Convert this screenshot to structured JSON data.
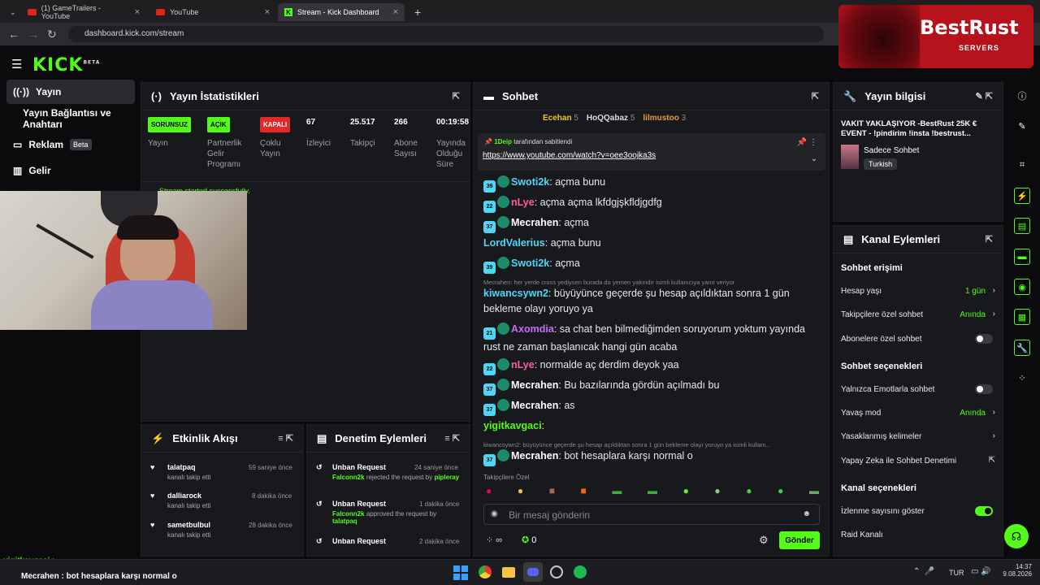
{
  "browser": {
    "tabs": [
      {
        "label": "(1) GameTrailers - YouTube"
      },
      {
        "label": "YouTube"
      },
      {
        "label": "Stream - Kick Dashboard"
      }
    ],
    "url": "dashboard.kick.com/stream"
  },
  "kick": {
    "logo": "KICK",
    "logo_sup": "BETA"
  },
  "sidebar": {
    "items": [
      {
        "label": "Yayın"
      },
      {
        "label": "Yayın Bağlantısı ve Anahtarı"
      },
      {
        "label": "Reklam",
        "badge": "Beta"
      },
      {
        "label": "Gelir"
      }
    ]
  },
  "overlay": {
    "brand": "BestRust",
    "brand_sub": "SERVERS"
  },
  "stats": {
    "title": "Yayın İstatistikleri",
    "items": [
      {
        "badge": "SORUNSUZ",
        "badge_color": "#53fc18",
        "label": "Yayın"
      },
      {
        "badge": "AÇIK",
        "badge_color": "#53fc18",
        "label": "Partnerlik Gelir Programı"
      },
      {
        "badge": "KAPALI",
        "badge_color": "#e02a2a",
        "label": "Çoklu Yayın"
      },
      {
        "value": "67",
        "label": "İzleyici"
      },
      {
        "value": "25.517",
        "label": "Takipçi"
      },
      {
        "value": "266",
        "label": "Abone Sayısı"
      },
      {
        "value": "00:19:58",
        "label": "Yayında Olduğu Süre"
      }
    ],
    "toast": "Stream started successfully."
  },
  "chat": {
    "title": "Sohbet",
    "top": [
      {
        "name": "Ecehan",
        "count": "5"
      },
      {
        "name": "HoQQabaz",
        "count": "5"
      },
      {
        "name": "lilmustoo",
        "count": "3"
      }
    ],
    "pinned": {
      "by": "1Deip",
      "by_suffix": "tarafından sabitlendi",
      "link": "https://www.youtube.com/watch?v=oee3oojka3s"
    },
    "messages": [
      {
        "badge": "39",
        "user": "Swoti2k",
        "color": "#4fd6f7",
        "text": "açma bunu"
      },
      {
        "badge": "22",
        "user": "nLye",
        "color": "#ff5ca8",
        "text": "açma açma lkfdgjşkfldjgdfg"
      },
      {
        "badge": "37",
        "user": "Mecrahen",
        "color": "#ffffff",
        "text": "açma"
      },
      {
        "badge": "",
        "user": "LordValerius",
        "color": "#4fd6f7",
        "text": "açma bunu"
      },
      {
        "badge": "39",
        "user": "Swoti2k",
        "color": "#4fd6f7",
        "text": "açma"
      },
      {
        "reply": "Mecrahen: her yerde cross yediysen burada da yemen yakındır isimli kullanıcıya yanıt veriyor"
      },
      {
        "badge": "",
        "user": "kiwancsywn2",
        "color": "#4fd6f7",
        "text": "büyüyünce geçerde şu hesap açıldıktan sonra 1 gün bekleme olayı yoruyo ya"
      },
      {
        "badge": "21",
        "user": "Axomdia",
        "color": "#c46bff",
        "text": "sa chat ben bilmediğimden soruyorum yoktum yayında rust ne zaman başlanıcak hangi gün acaba"
      },
      {
        "badge": "22",
        "user": "nLye",
        "color": "#ff5ca8",
        "text": "normalde aç derdim deyok yaa"
      },
      {
        "badge": "37",
        "user": "Mecrahen",
        "color": "#ffffff",
        "text": "Bu bazılarında gördün açılmadı bu"
      },
      {
        "badge": "37",
        "user": "Mecrahen",
        "color": "#ffffff",
        "text": "as"
      },
      {
        "badge": "",
        "user": "yigitkavgaci",
        "color": "#53fc18",
        "text": ""
      },
      {
        "reply": "kiwancsywn2: büyüyünce geçerde şu hesap açıldıktan sonra 1 gün bekleme olayı yoruyo ya isimli kullanı..."
      },
      {
        "badge": "37",
        "user": "Mecrahen",
        "color": "#ffffff",
        "text": "bot hesaplara karşı normal o"
      }
    ],
    "followers_only": "Takipçilere Özel",
    "input_placeholder": "Bir mesaj gönderin",
    "points": "0",
    "send": "Gönder"
  },
  "info": {
    "title": "Yayın bilgisi",
    "stream_title": "VAKIT YAKLAŞIYOR -BestRust 25K € EVENT - !pindirim !insta !bestrust...",
    "category": "Sadece Sohbet",
    "language": "Turkish"
  },
  "actions": {
    "title": "Kanal Eylemleri",
    "sections": [
      {
        "heading": "Sohbet erişimi"
      },
      {
        "heading": "Sohbet seçenekleri"
      },
      {
        "heading": "Kanal seçenekleri"
      }
    ],
    "rows": [
      {
        "label": "Hesap yaşı",
        "value": "1 gün"
      },
      {
        "label": "Takipçilere özel sohbet",
        "value": "Anında"
      },
      {
        "label": "Abonelere özel sohbet",
        "value": ""
      },
      {
        "label": "Yalnızca Emotlarla sohbet",
        "value": ""
      },
      {
        "label": "Yavaş mod",
        "value": "Anında"
      },
      {
        "label": "Yasaklanmış kelimeler",
        "value": ""
      },
      {
        "label": "Yapay Zeka ile Sohbet Denetimi",
        "value": ""
      },
      {
        "label": "İzlenme sayısını göster",
        "value": ""
      },
      {
        "label": "Raid Kanalı",
        "value": ""
      }
    ]
  },
  "events": {
    "title": "Etkinlik Akışı",
    "items": [
      {
        "user": "talatpaq",
        "action": "kanalı takip etti",
        "time": "59 saniye önce"
      },
      {
        "user": "dalliarock",
        "action": "kanalı takip etti",
        "time": "8 dakika önce"
      },
      {
        "user": "sametbulbul",
        "action": "kanalı takip etti",
        "time": "28 dakika önce"
      }
    ]
  },
  "moderation": {
    "title": "Denetim Eylemleri",
    "items": [
      {
        "title": "Unban Request",
        "time": "24 saniye önce",
        "mod": "Falconn2k",
        "text": "rejected the request by",
        "target": "pipleray"
      },
      {
        "title": "Unban Request",
        "time": "1 dakika önce",
        "mod": "Falconn2k",
        "text": "approved the request by",
        "target": "talatpaq"
      },
      {
        "title": "Unban Request",
        "time": "2 dakika önce",
        "mod": "Falconn2k",
        "text": "",
        "target": ""
      }
    ]
  },
  "stream_overlay": {
    "chat_user": "yigitkavgaci :",
    "chat_line": "Mecrahen : bot hesaplara karşı normal o"
  },
  "taskbar": {
    "lang": "TUR",
    "time": "14:37",
    "date": "9.08.2026"
  }
}
